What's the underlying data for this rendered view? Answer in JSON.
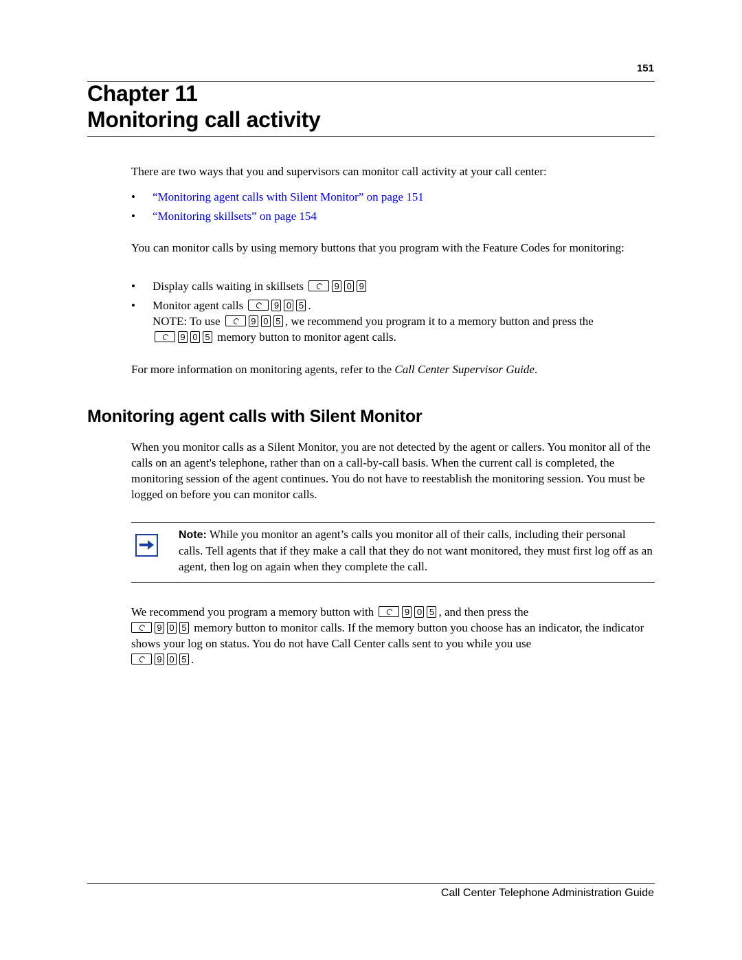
{
  "header": {
    "page_number": "151"
  },
  "chapter": {
    "line1": "Chapter 11",
    "line2": "Monitoring call activity"
  },
  "intro": {
    "text": "There are two ways that you and supervisors can monitor call activity at your call center:"
  },
  "links": [
    {
      "bullet": "•",
      "text": "“Monitoring agent calls with Silent Monitor” on page 151"
    },
    {
      "bullet": "•",
      "text": "“Monitoring skillsets” on page 154"
    }
  ],
  "memory_intro": {
    "text": "You can monitor calls by using memory buttons that you program with the Feature Codes for monitoring:"
  },
  "codes": {
    "item1": {
      "bullet": "•",
      "text": "Display calls waiting in skillsets",
      "keys": [
        "9",
        "0",
        "9"
      ]
    },
    "item2": {
      "bullet": "•",
      "text": "Monitor agent calls",
      "keys": [
        "9",
        "0",
        "5"
      ],
      "suffix": "."
    },
    "note": {
      "prefix": "NOTE: To use",
      "keys": [
        "9",
        "0",
        "5"
      ],
      "middle": ", we recommend you program it to a memory button and press the",
      "suffix": "memory button to monitor agent calls."
    }
  },
  "more_info": {
    "prefix": "For more information on monitoring agents, refer to the ",
    "guide": "Call Center Supervisor Guide",
    "suffix": "."
  },
  "section": {
    "title": "Monitoring agent calls with Silent Monitor",
    "paragraph": "When you monitor calls as a Silent Monitor, you are not detected by the agent or callers. You monitor all of the calls on an agent's telephone, rather than on a call-by-call basis. When the current call is completed, the monitoring session of the agent continues. You do not have to reestablish the monitoring session. You must be logged on before you can monitor calls."
  },
  "note_box": {
    "label": "Note:",
    "text": " While you monitor an agent’s calls you monitor all of their calls, including their personal calls. Tell agents that if they make a call that they do not want monitored, they must first log off as an agent, then log on again when they complete the call.",
    "icon": "arrow-right-icon",
    "icon_color": "#1a3fa0"
  },
  "recommend": {
    "part1": "We recommend you program a memory button with",
    "keys": [
      "9",
      "0",
      "5"
    ],
    "part2": ", and then press the",
    "part3": "memory button to monitor calls. If the memory button you choose has an indicator, the indicator shows your log on status. You do not have Call Center calls sent to you while you use",
    "part4": "."
  },
  "footer": {
    "title": "Call Center Telephone Administration Guide"
  },
  "colors": {
    "link": "#0000ee",
    "note_icon": "#1a3fa0"
  }
}
